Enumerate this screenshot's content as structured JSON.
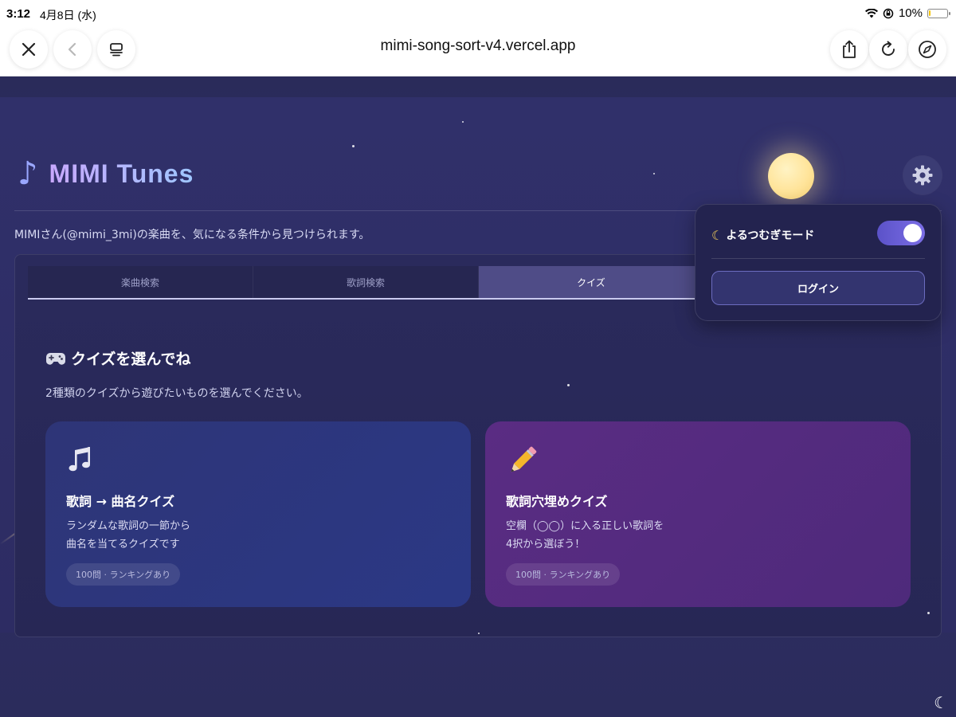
{
  "status_bar": {
    "time": "3:12",
    "date": "4月8日 (水)",
    "battery": "10%",
    "battery_level": 0.1
  },
  "browser": {
    "url": "mimi-song-sort-v4.vercel.app"
  },
  "app": {
    "title": "MIMI Tunes",
    "description": "MIMIさん(@mimi_3mi)の楽曲を、気になる条件から見つけられます。"
  },
  "tabs": [
    {
      "label": "楽曲検索",
      "active": false
    },
    {
      "label": "歌詞検索",
      "active": false
    },
    {
      "label": "クイズ",
      "active": true
    }
  ],
  "quiz": {
    "heading": "クイズを選んでね",
    "subtitle": "2種類のクイズから遊びたいものを選んでください。",
    "cards": [
      {
        "title": "歌詞 → 曲名クイズ",
        "line1": "ランダムな歌詞の一節から",
        "line2": "曲名を当てるクイズです",
        "badge": "100問 · ランキングあり"
      },
      {
        "title": "歌詞穴埋めクイズ",
        "line1": "空欄（◯◯）に入る正しい歌詞を",
        "line2": "4択から選ぼう！",
        "badge": "100問 · ランキングあり"
      }
    ]
  },
  "settings_popover": {
    "mode_label": "よるつむぎモード",
    "mode_on": true,
    "login_label": "ログイン"
  },
  "colors": {
    "accent": "#6b5fe0",
    "background": "#2d2c63",
    "card_blue": "#2c3680",
    "card_purple": "#55297f"
  },
  "icons": [
    "close-icon",
    "back-icon",
    "tabs-icon",
    "share-icon",
    "reload-icon",
    "compass-icon",
    "gear-icon",
    "music-note-icon",
    "moon-icon",
    "game-controller-icon",
    "musical-notes-icon",
    "pencil-icon"
  ]
}
